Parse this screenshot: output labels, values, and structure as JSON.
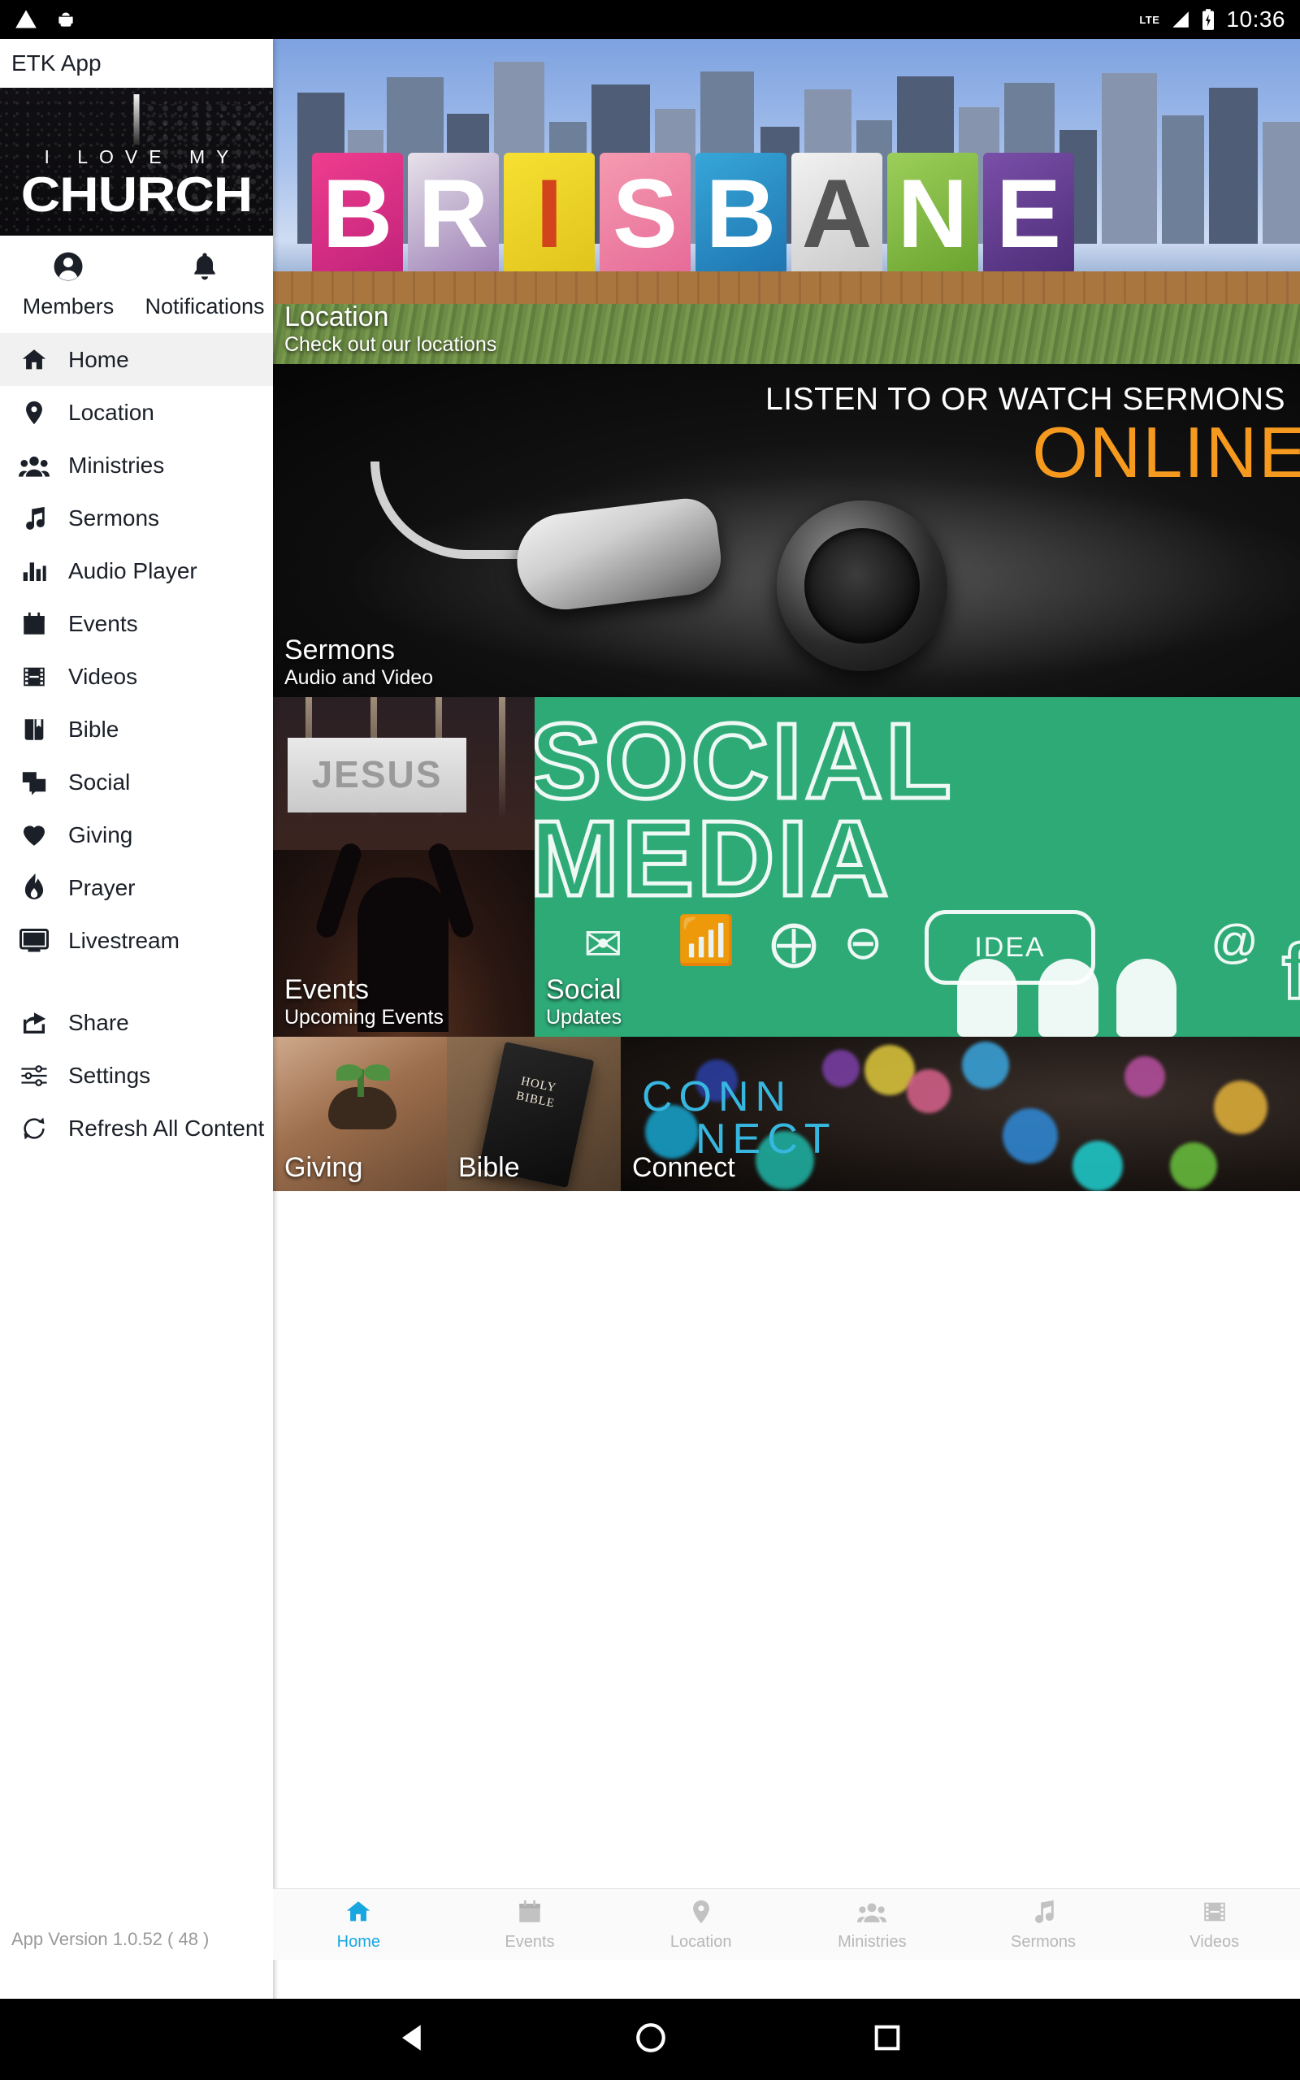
{
  "statusbar": {
    "time": "10:36",
    "network": "LTE",
    "icons": [
      "warning-icon",
      "android-robot-icon",
      "lte-signal-icon",
      "battery-charging-icon"
    ]
  },
  "sidebar": {
    "app_title": "ETK App",
    "logo": {
      "line1": "I LOVE MY",
      "line2": "CHURCH"
    },
    "quick": [
      {
        "label": "Members",
        "icon": "person-circle-icon"
      },
      {
        "label": "Notifications",
        "icon": "bell-icon"
      }
    ],
    "menu": [
      {
        "label": "Home",
        "icon": "home-icon",
        "active": true
      },
      {
        "label": "Location",
        "icon": "map-pin-icon",
        "active": false
      },
      {
        "label": "Ministries",
        "icon": "people-group-icon",
        "active": false
      },
      {
        "label": "Sermons",
        "icon": "music-note-icon",
        "active": false
      },
      {
        "label": "Audio Player",
        "icon": "equalizer-bars-icon",
        "active": false
      },
      {
        "label": "Events",
        "icon": "calendar-icon",
        "active": false
      },
      {
        "label": "Videos",
        "icon": "film-strip-icon",
        "active": false
      },
      {
        "label": "Bible",
        "icon": "book-bookmark-icon",
        "active": false
      },
      {
        "label": "Social",
        "icon": "chat-bubbles-icon",
        "active": false
      },
      {
        "label": "Giving",
        "icon": "heart-icon",
        "active": false
      },
      {
        "label": "Prayer",
        "icon": "flame-icon",
        "active": false
      },
      {
        "label": "Livestream",
        "icon": "tv-monitor-icon",
        "active": false
      }
    ],
    "menu_secondary": [
      {
        "label": "Share",
        "icon": "share-arrow-icon"
      },
      {
        "label": "Settings",
        "icon": "sliders-icon"
      },
      {
        "label": "Refresh All Content",
        "icon": "refresh-circular-icon"
      }
    ],
    "version": "App Version 1.0.52 ( 48 )"
  },
  "tiles": {
    "location": {
      "title": "Location",
      "subtitle": "Check out our locations",
      "sign_text": "BRISBANE"
    },
    "sermons": {
      "title": "Sermons",
      "subtitle": "Audio and Video",
      "banner_line1": "LISTEN TO OR WATCH SERMONS",
      "banner_line2": "ONLINE",
      "banner_accent": "#F59A1E"
    },
    "events": {
      "title": "Events",
      "subtitle": "Upcoming Events",
      "stage_text": "JESUS"
    },
    "social": {
      "title": "Social",
      "subtitle": "Updates",
      "big_line1": "SOCIAL",
      "big_line2": "MEDIA",
      "bubble_text": "IDEA",
      "brand_color": "#2eaa77"
    },
    "giving": {
      "title": "Giving"
    },
    "bible": {
      "title": "Bible",
      "cover_line1": "HOLY",
      "cover_line2": "BIBLE"
    },
    "connect": {
      "title": "Connect",
      "art_line1": "CONN",
      "art_line2": "NECT"
    }
  },
  "bottomnav": {
    "active_color": "#17a6e0",
    "items": [
      {
        "label": "Home",
        "icon": "home-icon",
        "active": true
      },
      {
        "label": "Events",
        "icon": "calendar-icon",
        "active": false
      },
      {
        "label": "Location",
        "icon": "map-pin-icon",
        "active": false
      },
      {
        "label": "Ministries",
        "icon": "people-group-icon",
        "active": false
      },
      {
        "label": "Sermons",
        "icon": "music-note-icon",
        "active": false
      },
      {
        "label": "Videos",
        "icon": "film-strip-icon",
        "active": false
      }
    ]
  },
  "androidbar": {
    "buttons": [
      "back-triangle-button",
      "home-circle-button",
      "recents-square-button"
    ]
  }
}
